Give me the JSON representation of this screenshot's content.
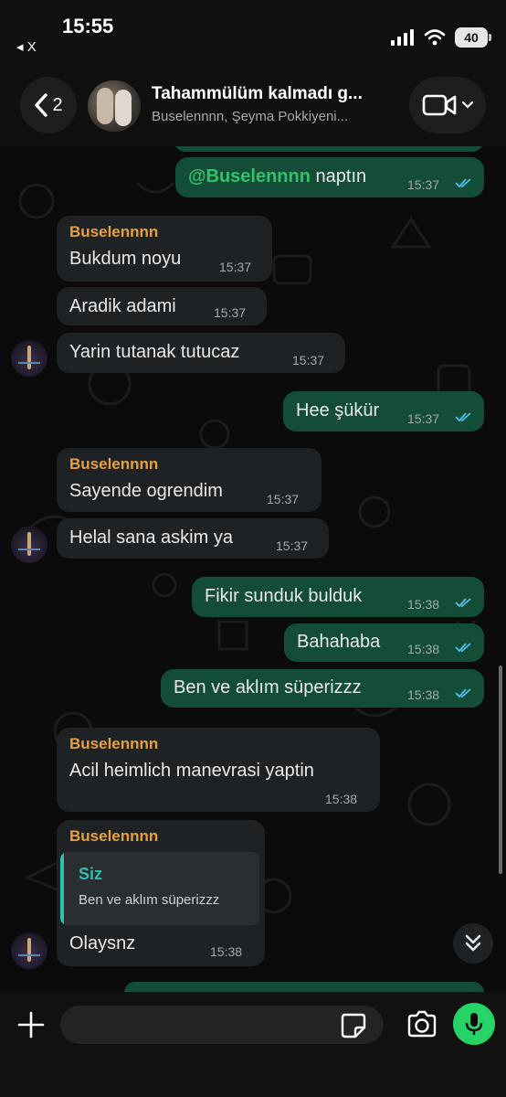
{
  "status": {
    "time": "15:55",
    "back_app": "◂ X",
    "battery": "40"
  },
  "header": {
    "back_count": "2",
    "title": "Tahammülüm kalmadı g...",
    "subtitle": "Buselennnn, Şeyma Pokkiyeni..."
  },
  "messages": [
    {
      "id": "m1",
      "dir": "out",
      "mention": "@Buselennnn",
      "text": " naptın",
      "time": "15:37"
    },
    {
      "id": "m2",
      "dir": "in",
      "sender": "Buselennnn",
      "text": "Bukdum noyu",
      "time": "15:37"
    },
    {
      "id": "m3",
      "dir": "in",
      "text": "Aradik adami",
      "time": "15:37"
    },
    {
      "id": "m4",
      "dir": "in",
      "text": "Yarin tutanak tutucaz",
      "time": "15:37"
    },
    {
      "id": "m5",
      "dir": "out",
      "text": "Hee şükür",
      "time": "15:37"
    },
    {
      "id": "m6",
      "dir": "in",
      "sender": "Buselennnn",
      "text": "Sayende ogrendim",
      "time": "15:37"
    },
    {
      "id": "m7",
      "dir": "in",
      "text": "Helal sana askim ya",
      "time": "15:37"
    },
    {
      "id": "m8",
      "dir": "out",
      "text": "Fikir sunduk bulduk",
      "time": "15:38"
    },
    {
      "id": "m9",
      "dir": "out",
      "text": "Bahahaba",
      "time": "15:38"
    },
    {
      "id": "m10",
      "dir": "out",
      "text": "Ben ve aklım süperizzz",
      "time": "15:38"
    },
    {
      "id": "m11",
      "dir": "in",
      "sender": "Buselennnn",
      "text": "Acil heimlich  manevrasi yaptin",
      "time": "15:38"
    },
    {
      "id": "m12",
      "dir": "in",
      "sender": "Buselennnn",
      "quote_name": "Siz",
      "quote_text": "Ben ve aklım süperizzz",
      "text": "Olaysnz",
      "time": "15:38"
    }
  ],
  "colors": {
    "outgoing_bubble": "#144d37",
    "incoming_bubble": "#1f2225",
    "sender_name": "#e8a13a",
    "mention": "#33c26b",
    "quote_accent": "#2fbfae",
    "read_ticks": "#53bdeb",
    "mic_button": "#25d366"
  },
  "icons": {
    "back": "chevron-left-icon",
    "video": "video-camera-icon",
    "dropdown": "chevron-down-icon",
    "attach": "plus-icon",
    "sticker": "sticker-icon",
    "camera": "camera-icon",
    "mic": "microphone-icon",
    "scroll": "double-chevron-down-icon"
  }
}
